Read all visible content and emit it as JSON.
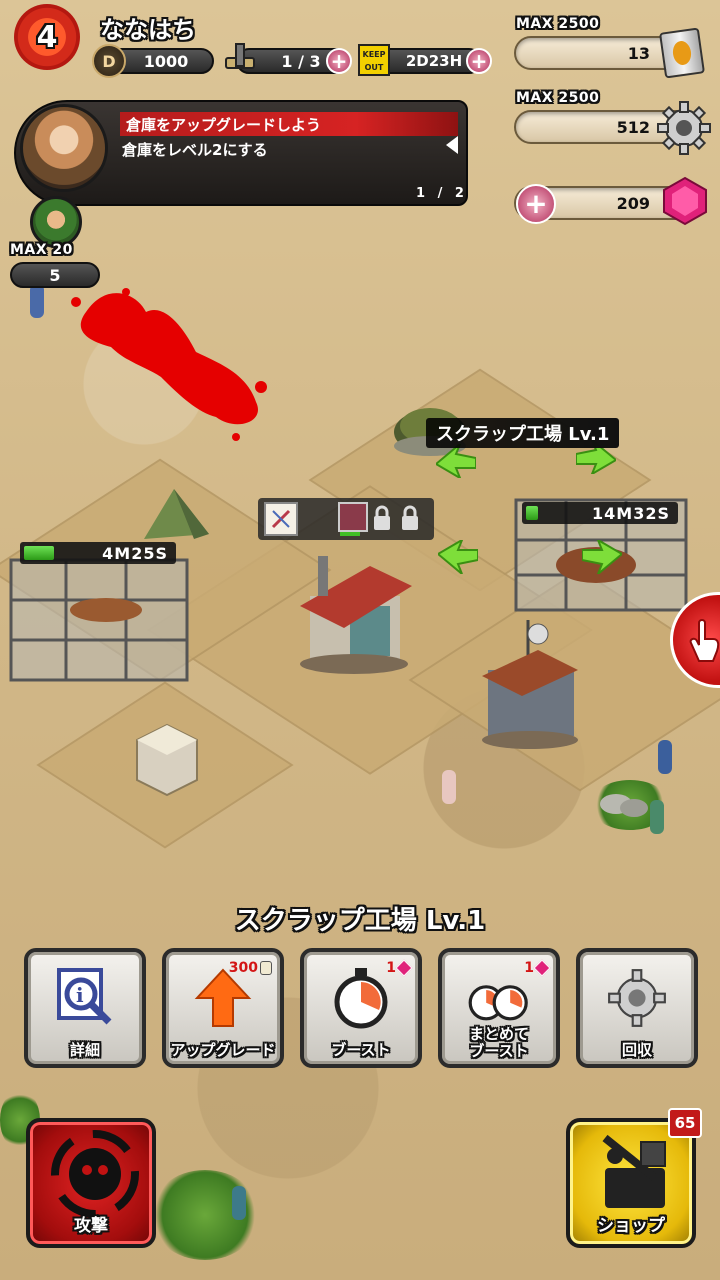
{
  "player": {
    "level": "4",
    "name": "ななはち",
    "currency_icon": "D",
    "currency": "1000",
    "workers": "1 / 3",
    "shield_icon": "KEEP OUT",
    "shield_time": "2D23H"
  },
  "resources": {
    "scrap_max": "MAX 2500",
    "scrap_value": "13",
    "parts_max": "MAX 2500",
    "parts_value": "512",
    "gems_value": "209"
  },
  "quest": {
    "title": "倉庫をアップグレードしよう",
    "description": "倉庫をレベル2にする",
    "page": "1 / 2"
  },
  "population": {
    "max": "MAX 20",
    "value": "5"
  },
  "map": {
    "building_label": "スクラップ工場 Lv.1",
    "timer_right": "14M32S",
    "timer_right_progress": 0.08,
    "timer_left": "4M25S",
    "timer_left_progress": 0.2,
    "lock_icons": [
      "lock-icon",
      "lock-icon"
    ]
  },
  "selected": {
    "name": "スクラップ工場 Lv.1"
  },
  "actions": [
    {
      "label": "詳細",
      "icon": "info-magnifier-icon",
      "cost": ""
    },
    {
      "label": "アップグレード",
      "icon": "upgrade-arrow-icon",
      "cost": "300"
    },
    {
      "label": "ブースト",
      "icon": "stopwatch-icon",
      "cost": "1"
    },
    {
      "label": "まとめて\nブースト",
      "icon": "double-stopwatch-icon",
      "cost": "1"
    },
    {
      "label": "回収",
      "icon": "gear-icon",
      "cost": ""
    }
  ],
  "bottom": {
    "attack_label": "攻撃",
    "shop_label": "ショップ",
    "shop_badge": "65"
  },
  "colors": {
    "ground": "#d8bf8f",
    "blood_red": "#e50000",
    "timer_green": "#3fbf25",
    "gem_pink": "#e0217a",
    "attack_red": "#c21212",
    "shop_yellow": "#f1c60f"
  }
}
